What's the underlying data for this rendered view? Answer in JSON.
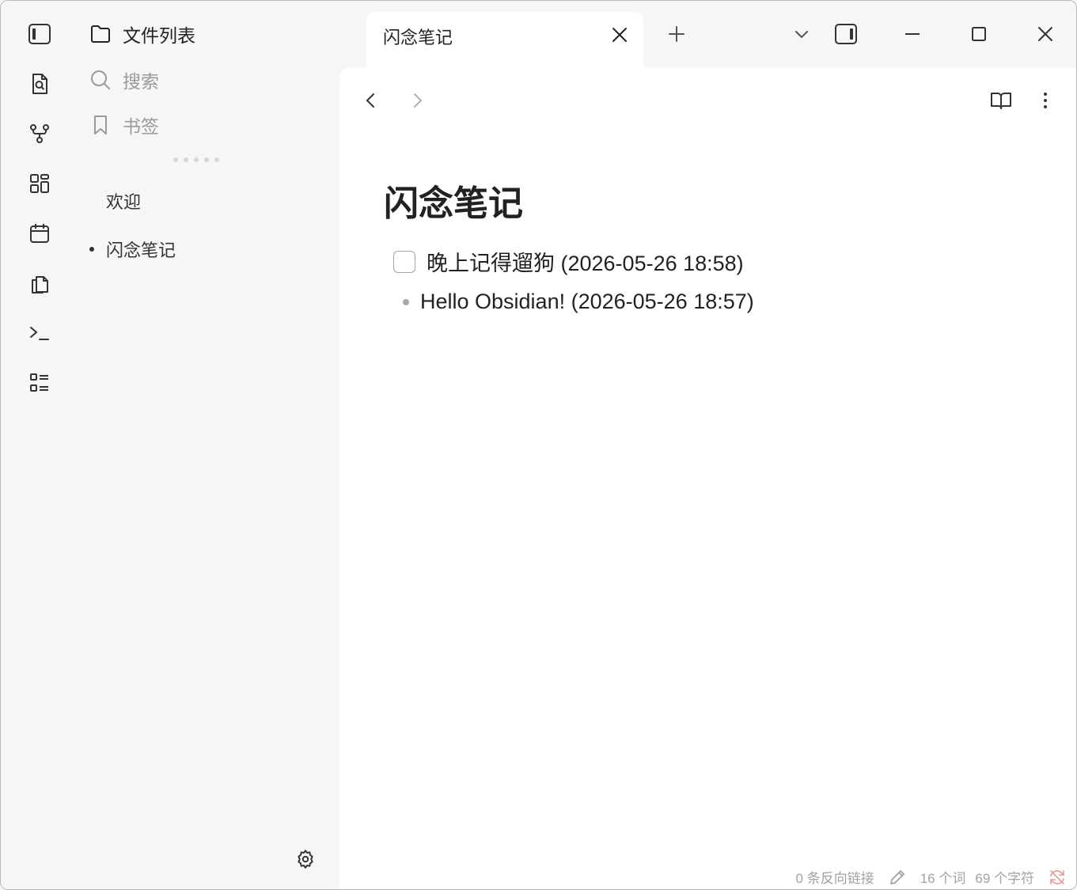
{
  "sidebar": {
    "header_label": "文件列表",
    "search_label": "搜索",
    "bookmarks_label": "书签",
    "files": [
      {
        "name": "欢迎",
        "active": false
      },
      {
        "name": "闪念笔记",
        "active": true
      }
    ]
  },
  "tab": {
    "title": "闪念笔记"
  },
  "document": {
    "title": "闪念笔记",
    "task_text": "晚上记得遛狗 (2026-05-26 18:58)",
    "task_checked": false,
    "bullet_text": "Hello Obsidian! (2026-05-26 18:57)"
  },
  "status": {
    "backlinks": "0 条反向链接",
    "words": "16 个词",
    "chars": "69 个字符"
  },
  "colors": {
    "sidebar_bg": "#f6f6f6",
    "editor_bg": "#ffffff",
    "sync_icon": "#e8a0a0"
  },
  "icons": {
    "ribbon": [
      "sidebar-toggle-icon",
      "file-search-icon",
      "graph-icon",
      "grid-icon",
      "calendar-icon",
      "copy-icon",
      "terminal-icon",
      "list-icon"
    ]
  }
}
